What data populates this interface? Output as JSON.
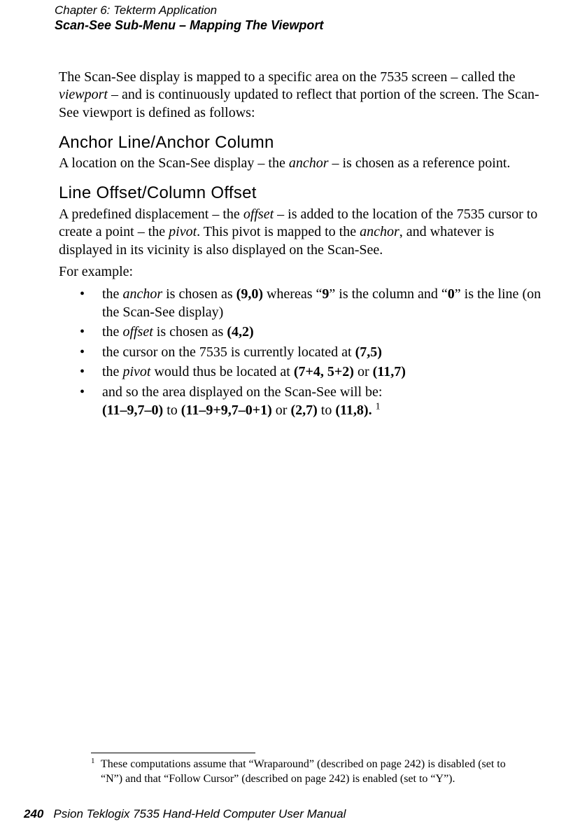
{
  "header": {
    "chapter": "Chapter 6: Tekterm Application",
    "section": "Scan-See Sub-Menu – Mapping The Viewport"
  },
  "intro": {
    "pre": "The Scan-See display is mapped to a specific area on the 7535 screen – called the ",
    "term": "viewport",
    "post": " – and is continuously updated to reflect that portion of the screen. The Scan-See viewport is defined as follows:"
  },
  "anchor": {
    "heading": "Anchor Line/Anchor Column",
    "pre": "A location on the Scan-See display – the ",
    "term": "anchor",
    "post": " – is chosen as a reference point."
  },
  "offset": {
    "heading": "Line Offset/Column Offset",
    "p1_a": "A predefined displacement – the ",
    "p1_offset": "offset",
    "p1_b": " – is added to the location of the 7535 cursor to create a point – the ",
    "p1_pivot": "pivot",
    "p1_c": ". This pivot is mapped to the ",
    "p1_anchor": "anchor",
    "p1_d": ", and whatever is displayed in its vicinity is also displayed on the Scan-See.",
    "example_label": "For example:"
  },
  "bullets": {
    "b1_a": "the ",
    "b1_anchor": "anchor",
    "b1_b": " is chosen as ",
    "b1_val": "(9,0)",
    "b1_c": " whereas “",
    "b1_nine": "9",
    "b1_d": "” is the column and “",
    "b1_zero": "0",
    "b1_e": "” is the line (on the Scan-See display)",
    "b2_a": "the ",
    "b2_offset": "offset",
    "b2_b": " is chosen as ",
    "b2_val": "(4,2)",
    "b3_a": "the cursor on the 7535 is currently located at ",
    "b3_val": "(7,5)",
    "b4_a": "the ",
    "b4_pivot": "pivot",
    "b4_b": " would thus be located at ",
    "b4_v1": "(7+4, 5+2)",
    "b4_or": " or ",
    "b4_v2": "(11,7)",
    "b5_a": "and so the area displayed on the Scan-See will be:",
    "b5_v1": "(11–9,7–0)",
    "b5_to1": " to ",
    "b5_v2": "(11–9+9,7–0+1)",
    "b5_or": " or ",
    "b5_v3": "(2,7)",
    "b5_to2": " to ",
    "b5_v4": "(11,8).",
    "b5_sup": "1"
  },
  "footnote": {
    "mark": "1",
    "text": "These computations assume that “Wraparound” (described on page 242) is disabled (set to “N”) and that “Follow Cursor” (described on page 242) is enabled (set to “Y”)."
  },
  "footer": {
    "pagenum": "240",
    "manual": "Psion Teklogix 7535 Hand-Held Computer User Manual"
  }
}
